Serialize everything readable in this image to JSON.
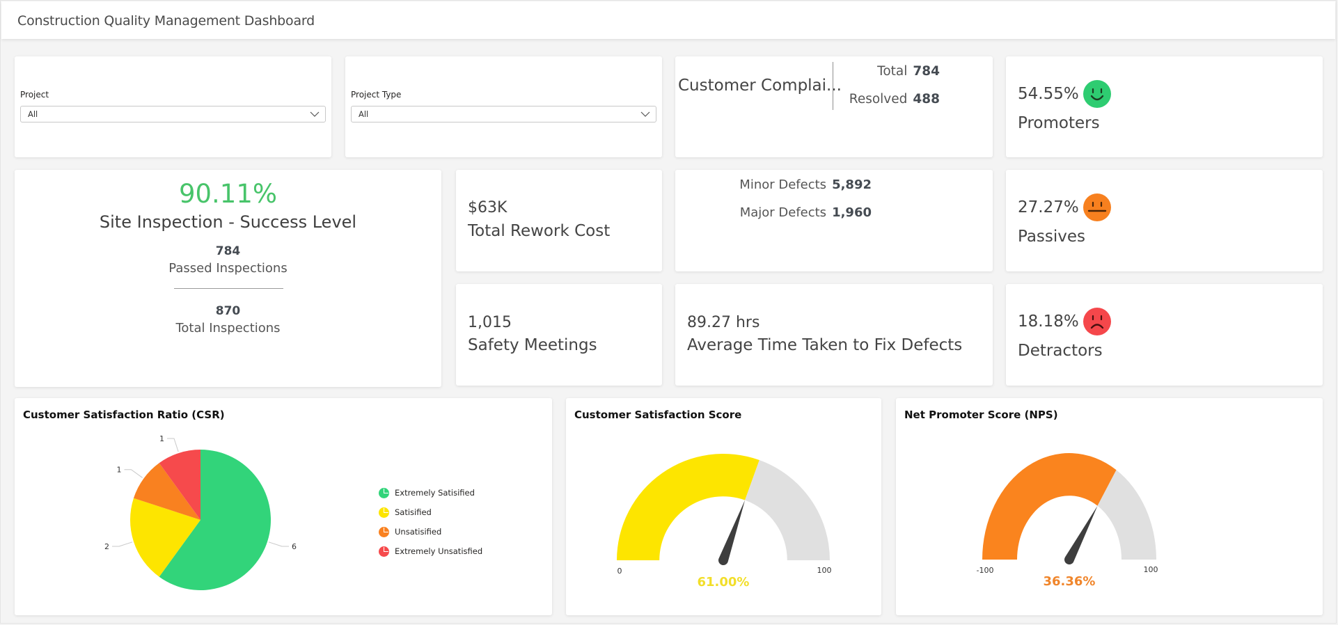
{
  "header": {
    "title": "Construction Quality Management Dashboard"
  },
  "filters": {
    "project": {
      "label": "Project",
      "value": "All"
    },
    "project_type": {
      "label": "Project Type",
      "value": "All"
    }
  },
  "complaints": {
    "title": "Customer Complai...",
    "total_label": "Total",
    "total_value": "784",
    "resolved_label": "Resolved",
    "resolved_value": "488"
  },
  "nps_breakdown": {
    "promoters": {
      "value": "54.55%",
      "label": "Promoters",
      "icon": "smile-face-icon",
      "color": "#2ecc71"
    },
    "passives": {
      "value": "27.27%",
      "label": "Passives",
      "icon": "neutral-face-icon",
      "color": "#f7801f"
    },
    "detractors": {
      "value": "18.18%",
      "label": "Detractors",
      "icon": "sad-face-icon",
      "color": "#f5474b"
    }
  },
  "site_inspection": {
    "success_level": "90.11%",
    "title": "Site Inspection - Success Level",
    "passed_value": "784",
    "passed_label": "Passed Inspections",
    "total_value": "870",
    "total_label": "Total Inspections",
    "accent": "#48c46a"
  },
  "rework": {
    "value": "$63K",
    "label": "Total Rework Cost"
  },
  "defects": {
    "minor_label": "Minor Defects",
    "minor_value": "5,892",
    "major_label": "Major Defects",
    "major_value": "1,960"
  },
  "safety": {
    "value": "1,015",
    "label": "Safety Meetings"
  },
  "fix_time": {
    "value": "89.27 hrs",
    "label": "Average Time Taken to Fix Defects"
  },
  "chart_data": [
    {
      "type": "pie",
      "title": "Customer Satisfaction Ratio (CSR)",
      "categories": [
        "Extremely Satisified",
        "Satisified",
        "Unsatisified",
        "Extremely Unsatisfied"
      ],
      "values": [
        6,
        2,
        1,
        1
      ],
      "colors": [
        "#32d47a",
        "#fde500",
        "#f98120",
        "#f64a4c"
      ],
      "legend": "right",
      "data_labels": true
    },
    {
      "type": "gauge",
      "title": "Customer Satisfaction Score",
      "value": 61,
      "min": 0,
      "max": 100,
      "min_label": "0",
      "max_label": "100",
      "value_label": "61.00%",
      "fill_color": "#fde500",
      "track_color": "#e0e0e0",
      "value_color": "#f2de29"
    },
    {
      "type": "gauge",
      "title": "Net Promoter Score (NPS)",
      "value": 36.36,
      "min": -100,
      "max": 100,
      "min_label": "-100",
      "max_label": "100",
      "value_label": "36.36%",
      "fill_color": "#fa841e",
      "track_color": "#e0e0e0",
      "value_color": "#f0862c"
    }
  ]
}
